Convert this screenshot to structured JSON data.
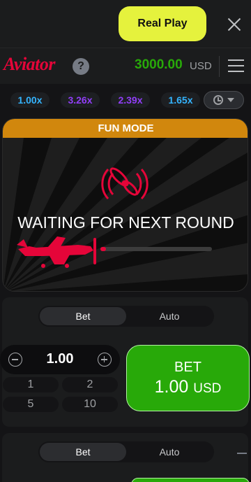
{
  "topbar": {
    "real_play_label": "Real Play"
  },
  "header": {
    "logo_text": "Aviator",
    "help_label": "?",
    "balance": "3000.00",
    "currency": "USD"
  },
  "history": {
    "multipliers": [
      {
        "value": "1.00x",
        "color": "#34b4ff"
      },
      {
        "value": "3.26x",
        "color": "#913ef8"
      },
      {
        "value": "2.39x",
        "color": "#913ef8"
      },
      {
        "value": "1.65x",
        "color": "#34b4ff"
      }
    ]
  },
  "stage": {
    "mode_label": "FUN MODE",
    "status_text": "WAITING FOR NEXT ROUND",
    "progress": 0.05
  },
  "bet_panel_1": {
    "tabs": [
      "Bet",
      "Auto"
    ],
    "amount": "1.00",
    "quick_amounts": [
      "1",
      "2",
      "5",
      "10"
    ],
    "bet_label": "BET",
    "bet_amount": "1.00",
    "bet_currency": "USD"
  },
  "bet_panel_2": {
    "tabs": [
      "Bet",
      "Auto"
    ]
  },
  "colors": {
    "accent": "#e50539",
    "green": "#28a909",
    "fun_mode": "#d1870d",
    "real_play": "#e5f23d"
  }
}
